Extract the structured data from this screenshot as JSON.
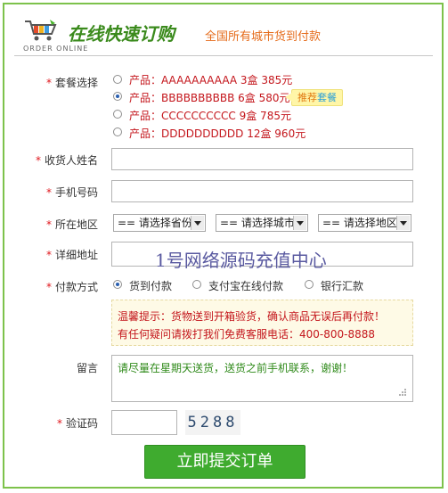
{
  "header": {
    "title": "在线快速订购",
    "subtitle": "全国所有城市货到付款",
    "english": "ORDER ONLINE"
  },
  "form": {
    "package": {
      "label": "套餐选择",
      "options": [
        {
          "text": "产品：AAAAAAAAAA 3盒 385元",
          "selected": false
        },
        {
          "text": "产品：BBBBBBBBBB 6盒 580元",
          "selected": true
        },
        {
          "text": "产品：CCCCCCCCCC 9盒 785元",
          "selected": false
        },
        {
          "text": "产品：DDDDDDDDDD 12盒 960元",
          "selected": false
        }
      ],
      "badge_part1": "推荐",
      "badge_part2": "套餐"
    },
    "name": {
      "label": "收货人姓名",
      "value": ""
    },
    "phone": {
      "label": "手机号码",
      "value": ""
    },
    "region": {
      "label": "所在地区",
      "province": "== 请选择省份",
      "city": "== 请选择城市",
      "district": "== 请选择地区"
    },
    "address": {
      "label": "详细地址",
      "value": ""
    },
    "payment": {
      "label": "付款方式",
      "options": [
        {
          "text": "货到付款",
          "selected": true
        },
        {
          "text": "支付宝在线付款",
          "selected": false
        },
        {
          "text": "银行汇款",
          "selected": false
        }
      ]
    },
    "notice": {
      "line1": "温馨提示：货物送到开箱验货，确认商品无误后再付款！",
      "line2": "有任何疑问请拨打我们免费客服电话：400-800-8888"
    },
    "message": {
      "label": "留言",
      "value": "请尽量在星期天送货，送货之前手机联系，谢谢！"
    },
    "captcha": {
      "label": "验证码",
      "value": "",
      "code": "5288"
    },
    "submit_label": "立即提交订单"
  },
  "watermark": "1号网络源码充值中心",
  "required_mark": "*"
}
